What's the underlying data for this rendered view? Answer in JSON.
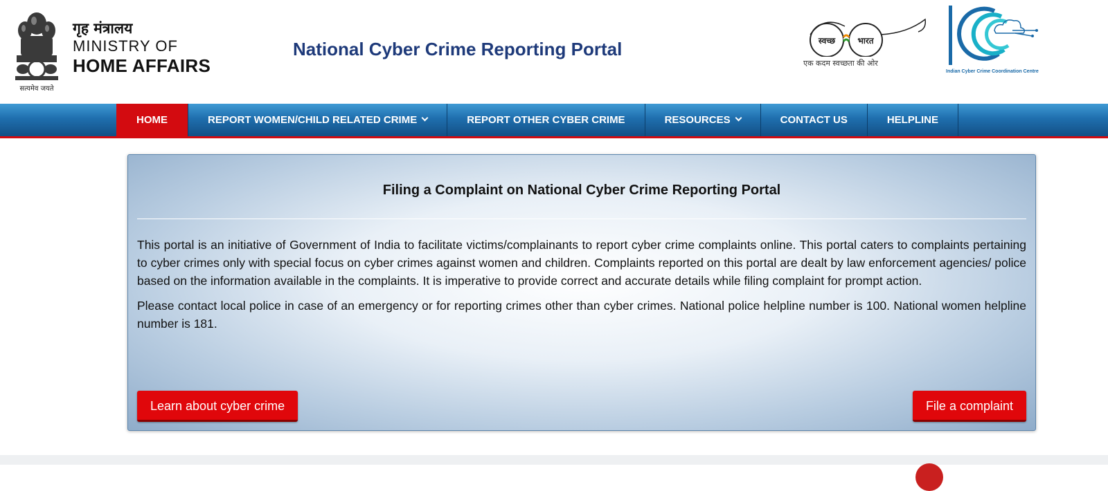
{
  "header": {
    "emblem_motto": "सत्यमेव जयते",
    "ministry_hindi": "गृह मंत्रालय",
    "ministry_line1": "MINISTRY OF",
    "ministry_line2": "HOME AFFAIRS",
    "portal_title": "National Cyber Crime Reporting Portal",
    "swachh_text_left": "स्वच्छ",
    "swachh_text_right": "भारत",
    "swachh_tagline": "एक कदम स्वच्छता की ओर",
    "i4c_caption": "Indian Cyber Crime Coordination Centre"
  },
  "nav": {
    "items": [
      {
        "label": "HOME",
        "active": true
      },
      {
        "label": "REPORT WOMEN/CHILD RELATED CRIME",
        "dropdown": true
      },
      {
        "label": "REPORT OTHER CYBER CRIME"
      },
      {
        "label": "RESOURCES",
        "dropdown": true
      },
      {
        "label": "CONTACT US"
      },
      {
        "label": "HELPLINE"
      }
    ]
  },
  "card": {
    "title": "Filing a Complaint on National Cyber Crime Reporting Portal",
    "paragraph1": "This portal is an initiative of Government of India to facilitate victims/complainants to report cyber crime complaints online. This portal caters to complaints pertaining to cyber crimes only with special focus on cyber crimes against women and children. Complaints reported on this portal are dealt by law enforcement agencies/ police based on the information available in the complaints. It is imperative to provide correct and accurate details while filing complaint for prompt action.",
    "paragraph2": "Please contact local police in case of an emergency or for reporting crimes other than cyber crimes. National police helpline number is 100. National women helpline number is 181.",
    "learn_button": "Learn about cyber crime",
    "file_button": "File a complaint"
  },
  "colors": {
    "nav_blue": "#1f6fae",
    "accent_red": "#e0070b",
    "title_blue": "#1e3a7a"
  }
}
